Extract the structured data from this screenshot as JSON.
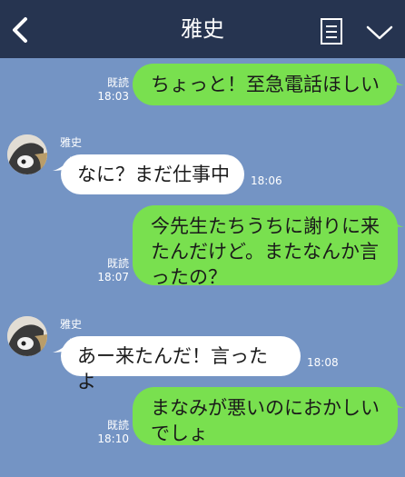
{
  "header": {
    "title": "雅史"
  },
  "read_label": "既読",
  "messages": [
    {
      "text": "ちょっと！至急電話ほしい",
      "time": "18:03"
    },
    {
      "sender": "雅史",
      "text": "なに？まだ仕事中",
      "time": "18:06"
    },
    {
      "text": "今先生たちうちに謝りに来\nたんだけど。またなんか言\nったの？",
      "time": "18:07"
    },
    {
      "sender": "雅史",
      "text": "あー来たんだ！言ったよ",
      "time": "18:08"
    },
    {
      "text": "まなみが悪いのにおかしい\nでしょ",
      "time": "18:10"
    }
  ],
  "colors": {
    "background": "#7494c4",
    "header": "#263450",
    "outgoing_bubble": "#79e04f",
    "incoming_bubble": "#ffffff"
  },
  "icons": [
    "back-chevron-icon",
    "menu-list-icon",
    "chevron-down-icon"
  ]
}
